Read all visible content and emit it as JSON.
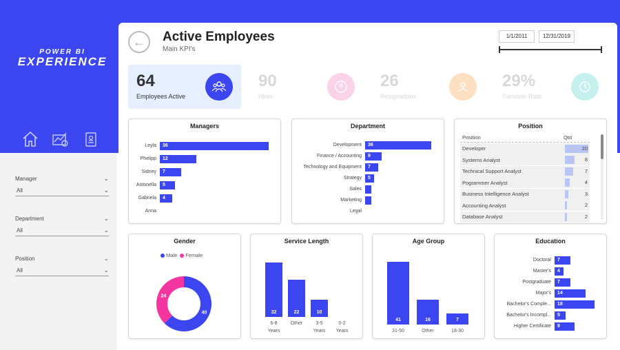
{
  "brand": {
    "line1": "POWER BI",
    "line2": "EXPERIENCE"
  },
  "colors": {
    "accent": "#3b45f0",
    "female": "#f436a1",
    "kpi_active_bg": "#e6efff"
  },
  "nav": {
    "icons": [
      "home-icon",
      "analytics-icon",
      "badge-icon"
    ]
  },
  "filters": [
    {
      "label": "Manager",
      "value": "All"
    },
    {
      "label": "Department",
      "value": "All"
    },
    {
      "label": "Position",
      "value": "All"
    }
  ],
  "header": {
    "title": "Active Employees",
    "subtitle": "Main KPI's",
    "date_start": "1/1/2011",
    "date_end": "12/31/2019"
  },
  "kpis": [
    {
      "value": "64",
      "label": "Employees Active",
      "active": true,
      "icon": "people-icon"
    },
    {
      "value": "90",
      "label": "Hires",
      "active": false,
      "icon": "group-icon"
    },
    {
      "value": "26",
      "label": "Resignations",
      "active": false,
      "icon": "team-icon"
    },
    {
      "value": "29%",
      "label": "Turnover Rate",
      "active": false,
      "icon": "refresh-icon"
    }
  ],
  "managers": {
    "title": "Managers",
    "rows": [
      {
        "name": "Leyla",
        "value": 36
      },
      {
        "name": "Phelipp",
        "value": 12
      },
      {
        "name": "Sidney",
        "value": 7
      },
      {
        "name": "Antonella",
        "value": 5
      },
      {
        "name": "Gabriela",
        "value": 4
      },
      {
        "name": "Anna",
        "value": null
      }
    ]
  },
  "department": {
    "title": "Department",
    "rows": [
      {
        "name": "Development",
        "value": 36
      },
      {
        "name": "Finance / Accounting",
        "value": 9
      },
      {
        "name": "Technology and Equipment",
        "value": 7
      },
      {
        "name": "Strategy",
        "value": 5
      },
      {
        "name": "Sales",
        "value": 3
      },
      {
        "name": "Marketing",
        "value": 2
      },
      {
        "name": "Legal",
        "value": null
      }
    ]
  },
  "position": {
    "title": "Position",
    "col1": "Position",
    "col2": "Qtd",
    "rows": [
      {
        "name": "Developer",
        "value": 20
      },
      {
        "name": "Systems Analyst",
        "value": 8
      },
      {
        "name": "Technical Support Analyst",
        "value": 7
      },
      {
        "name": "Pogrammer Analyst",
        "value": 4
      },
      {
        "name": "Business Intelligence Analyst",
        "value": 3
      },
      {
        "name": "Accounting Analyst",
        "value": 2
      },
      {
        "name": "Database Analyst",
        "value": 2
      }
    ]
  },
  "gender": {
    "title": "Gender",
    "legend": [
      "Male",
      "Female"
    ],
    "male": 40,
    "female": 24
  },
  "service": {
    "title": "Service Length",
    "bars": [
      {
        "label": "6-8 Years",
        "value": 32
      },
      {
        "label": "Other",
        "value": 22
      },
      {
        "label": "3-5 Years",
        "value": 10
      },
      {
        "label": "0-2 Years",
        "value": null
      }
    ]
  },
  "age": {
    "title": "Age Group",
    "bars": [
      {
        "label": "31-50",
        "value": 41
      },
      {
        "label": "Other",
        "value": 16
      },
      {
        "label": "18-30",
        "value": 7
      }
    ]
  },
  "education": {
    "title": "Education",
    "rows": [
      {
        "name": "Doctoral",
        "value": 7
      },
      {
        "name": "Master's",
        "value": 4
      },
      {
        "name": "Postgraduate",
        "value": 7
      },
      {
        "name": "Major's",
        "value": 14
      },
      {
        "name": "Bachelor's Comple...",
        "value": 18
      },
      {
        "name": "Bachelor's Incompl...",
        "value": 5
      },
      {
        "name": "Higher Certificate",
        "value": 9
      }
    ]
  },
  "chart_data": [
    {
      "type": "bar",
      "title": "Managers",
      "categories": [
        "Leyla",
        "Phelipp",
        "Sidney",
        "Antonella",
        "Gabriela",
        "Anna"
      ],
      "values": [
        36,
        12,
        7,
        5,
        4,
        null
      ]
    },
    {
      "type": "bar",
      "title": "Department",
      "categories": [
        "Development",
        "Finance / Accounting",
        "Technology and Equipment",
        "Strategy",
        "Sales",
        "Marketing",
        "Legal"
      ],
      "values": [
        36,
        9,
        7,
        5,
        3,
        2,
        null
      ]
    },
    {
      "type": "table",
      "title": "Position",
      "categories": [
        "Developer",
        "Systems Analyst",
        "Technical Support Analyst",
        "Pogrammer Analyst",
        "Business Intelligence Analyst",
        "Accounting Analyst",
        "Database Analyst"
      ],
      "values": [
        20,
        8,
        7,
        4,
        3,
        2,
        2
      ]
    },
    {
      "type": "pie",
      "title": "Gender",
      "categories": [
        "Male",
        "Female"
      ],
      "values": [
        40,
        24
      ]
    },
    {
      "type": "bar",
      "title": "Service Length",
      "categories": [
        "6-8 Years",
        "Other",
        "3-5 Years",
        "0-2 Years"
      ],
      "values": [
        32,
        22,
        10,
        null
      ]
    },
    {
      "type": "bar",
      "title": "Age Group",
      "categories": [
        "31-50",
        "Other",
        "18-30"
      ],
      "values": [
        41,
        16,
        7
      ]
    },
    {
      "type": "bar",
      "title": "Education",
      "categories": [
        "Doctoral",
        "Master's",
        "Postgraduate",
        "Major's",
        "Bachelor's Comple...",
        "Bachelor's Incompl...",
        "Higher Certificate"
      ],
      "values": [
        7,
        4,
        7,
        14,
        18,
        5,
        9
      ]
    }
  ]
}
